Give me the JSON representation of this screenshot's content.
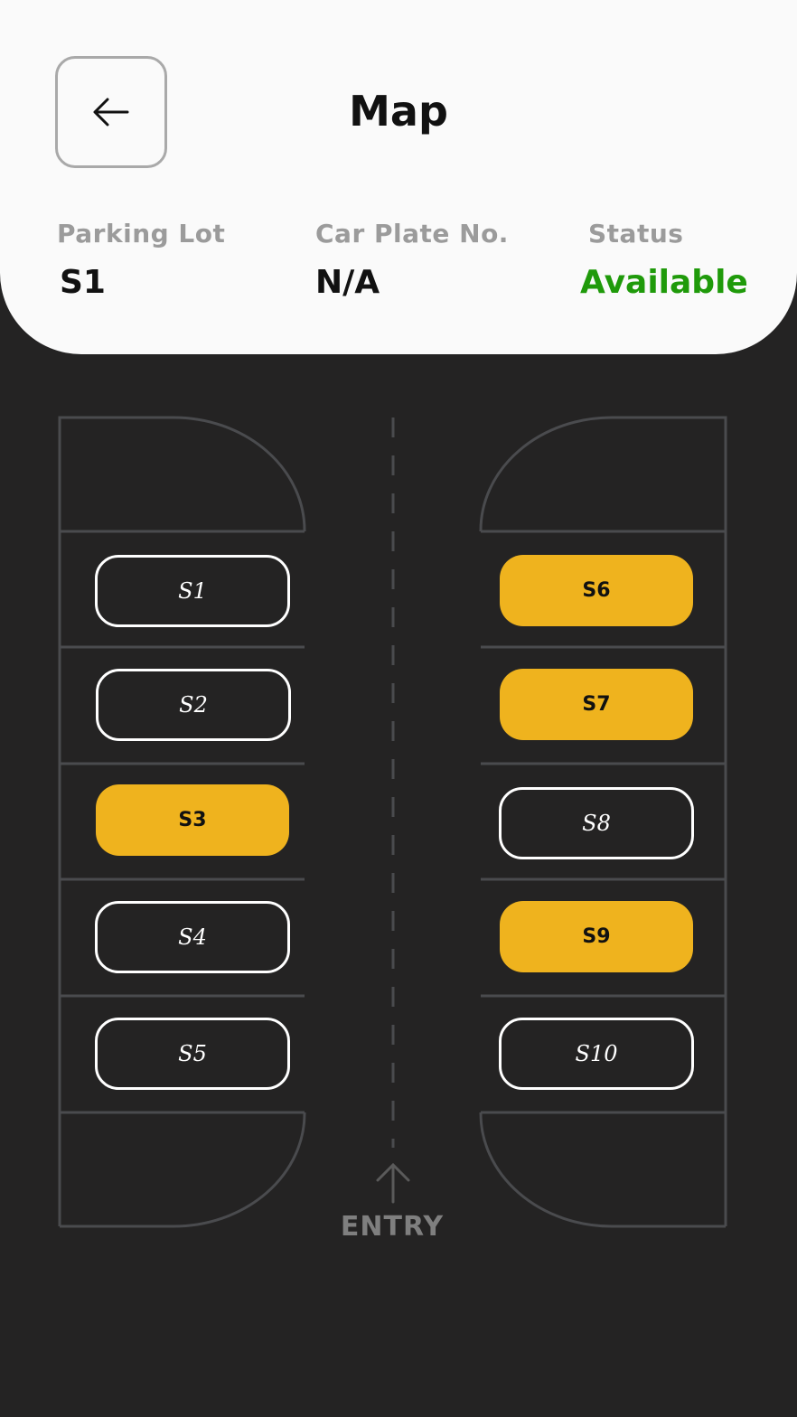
{
  "header": {
    "title": "Map",
    "back_icon": "arrow-left-icon"
  },
  "info": {
    "parking_lot_label": "Parking Lot",
    "parking_lot_value": "S1",
    "car_plate_label": "Car Plate No.",
    "car_plate_value": "N/A",
    "status_label": "Status",
    "status_value": "Available"
  },
  "colors": {
    "background": "#242323",
    "header_bg": "#fafafa",
    "occupied": "#efb31e",
    "available_status": "#1f9a0a",
    "lines": "#4a4b4e"
  },
  "slots": {
    "s1": {
      "label": "S1",
      "state": "free"
    },
    "s2": {
      "label": "S2",
      "state": "free"
    },
    "s3": {
      "label": "S3",
      "state": "occupied"
    },
    "s4": {
      "label": "S4",
      "state": "free"
    },
    "s5": {
      "label": "S5",
      "state": "free"
    },
    "s6": {
      "label": "S6",
      "state": "occupied"
    },
    "s7": {
      "label": "S7",
      "state": "occupied"
    },
    "s8": {
      "label": "S8",
      "state": "free"
    },
    "s9": {
      "label": "S9",
      "state": "occupied"
    },
    "s10": {
      "label": "S10",
      "state": "free"
    }
  },
  "entry": {
    "label": "ENTRY",
    "icon": "arrow-up-icon"
  }
}
